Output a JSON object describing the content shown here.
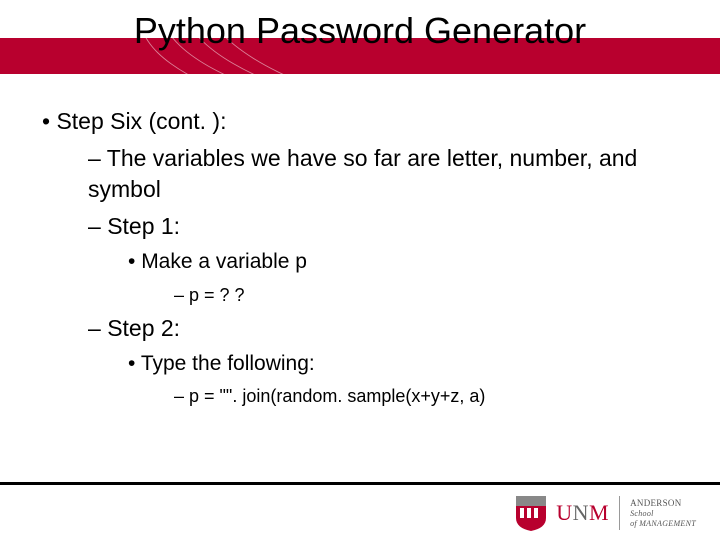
{
  "title": "Python Password Generator",
  "bullets": {
    "b1": "Step Six (cont. ):",
    "b2": "The variables we have so far are letter, number, and symbol",
    "b3": "Step 1:",
    "b4": "Make a variable p",
    "b5": "p = ? ?",
    "b6": "Step 2:",
    "b7": "Type the following:",
    "b8": "p = \"\". join(random. sample(x+y+z, a)"
  },
  "logo": {
    "main_u1": "U",
    "main_n": "N",
    "main_m": "M",
    "sub1": "ANDERSON",
    "sub2": "School",
    "sub3": "of MANAGEMENT"
  }
}
